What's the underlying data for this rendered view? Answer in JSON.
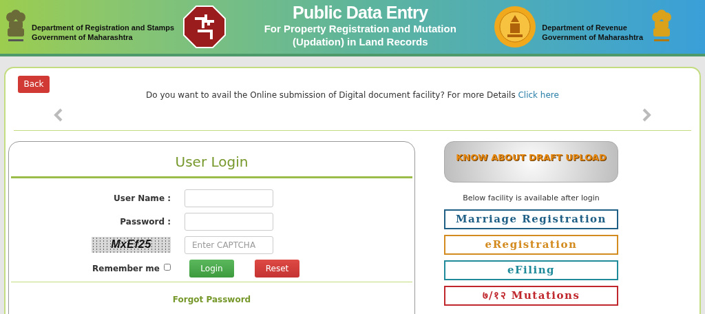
{
  "header": {
    "left_department": [
      "Department of Registration and Stamps",
      "Government of Maharashtra"
    ],
    "title": "Public Data Entry",
    "subtitle": [
      "For Property Registration and Mutation",
      "(Updation) in Land Records"
    ],
    "right_department": [
      "Department of Revenue",
      "Government of Maharashtra"
    ]
  },
  "notice": {
    "back_button": "Back",
    "message": "Do you want to avail the Online submission of Digital document facility? For more Details",
    "link": "Click here"
  },
  "login": {
    "title": "User Login",
    "fields": [
      {
        "kind": "text",
        "label": "User Name :"
      },
      {
        "kind": "password",
        "label": "Password :"
      },
      {
        "kind": "captcha",
        "captcha": "MxEf25",
        "placeholder": "Enter CAPTCHA"
      }
    ],
    "remember": {
      "label": "Remember me",
      "checked": false
    },
    "buttons": [
      {
        "kind": "primary",
        "label": "Login"
      },
      {
        "kind": "danger",
        "label": "Reset"
      }
    ],
    "forgot": "Forgot Password"
  },
  "draft_button": "KNOW ABOUT DRAFT UPLOAD",
  "facility_note": "Below facility is available after login",
  "facilities": [
    {
      "label": "Marriage Registration",
      "color": "#1f5f86"
    },
    {
      "label": "eRegistration",
      "color": "#d38a1e"
    },
    {
      "label": "eFiling",
      "color": "#1f8a9a"
    },
    {
      "label": "७/१२ Mutations",
      "color": "#c0272d"
    }
  ]
}
